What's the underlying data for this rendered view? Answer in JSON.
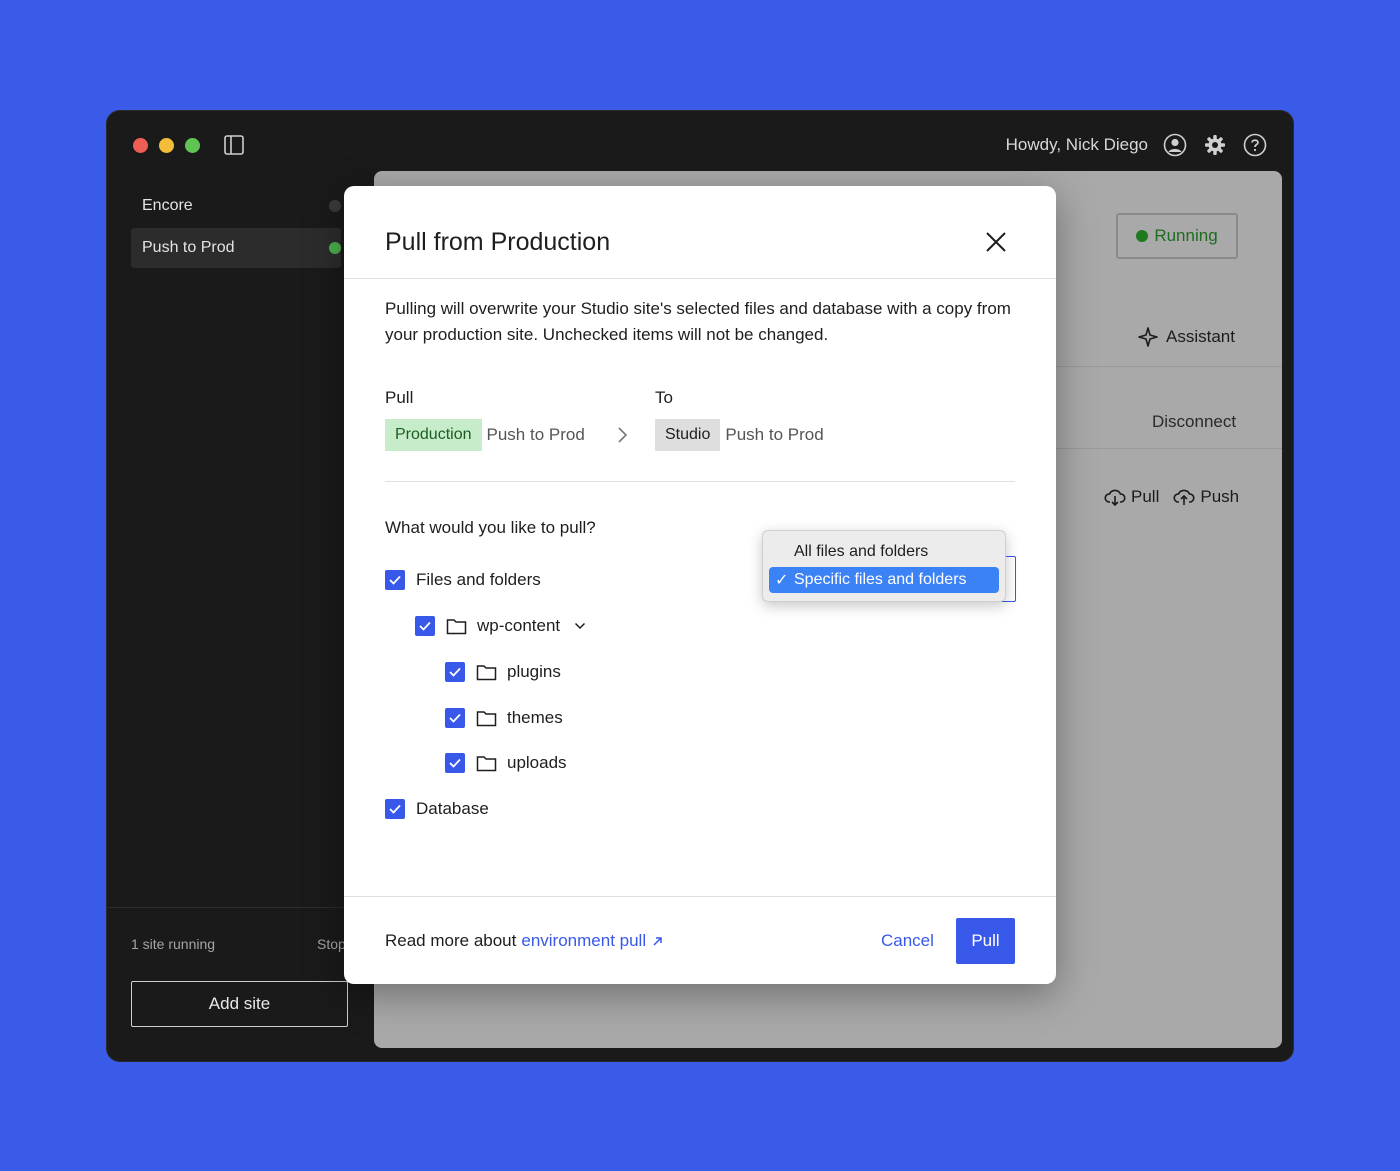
{
  "topbar": {
    "greeting": "Howdy, Nick Diego"
  },
  "sidebar": {
    "items": [
      {
        "label": "Encore",
        "status_color": "#3a3a3a"
      },
      {
        "label": "Push to Prod",
        "status_color": "#4caf50"
      }
    ],
    "running_text": "1 site running",
    "stop_text": "Stop",
    "add_site_label": "Add site"
  },
  "panel": {
    "status_badge": "Running",
    "assistant_label": "Assistant",
    "disconnect_label": "Disconnect",
    "pull_label": "Pull",
    "push_label": "Push"
  },
  "modal": {
    "title": "Pull from Production",
    "description": "Pulling will overwrite your Studio site's selected files and database with a copy from your production site. Unchecked items will not be changed.",
    "pull_label": "Pull",
    "to_label": "To",
    "source_env": "Production",
    "source_site": "Push to Prod",
    "target_env": "Studio",
    "target_site": "Push to Prod",
    "question": "What would you like to pull?",
    "dropdown": {
      "options": [
        "All files and folders",
        "Specific files and folders"
      ],
      "selected": "Specific files and folders"
    },
    "items": {
      "files": "Files and folders",
      "wp_content": "wp-content",
      "plugins": "plugins",
      "themes": "themes",
      "uploads": "uploads",
      "database": "Database"
    },
    "footer": {
      "read_more": "Read more about",
      "link_text": "environment pull",
      "cancel_label": "Cancel",
      "pull_button": "Pull"
    }
  },
  "colors": {
    "background": "#3a5be8",
    "accent": "#3858e9",
    "production_tag": "#c7ecca",
    "studio_tag": "#dedede",
    "running_green": "#1f7a1f"
  }
}
